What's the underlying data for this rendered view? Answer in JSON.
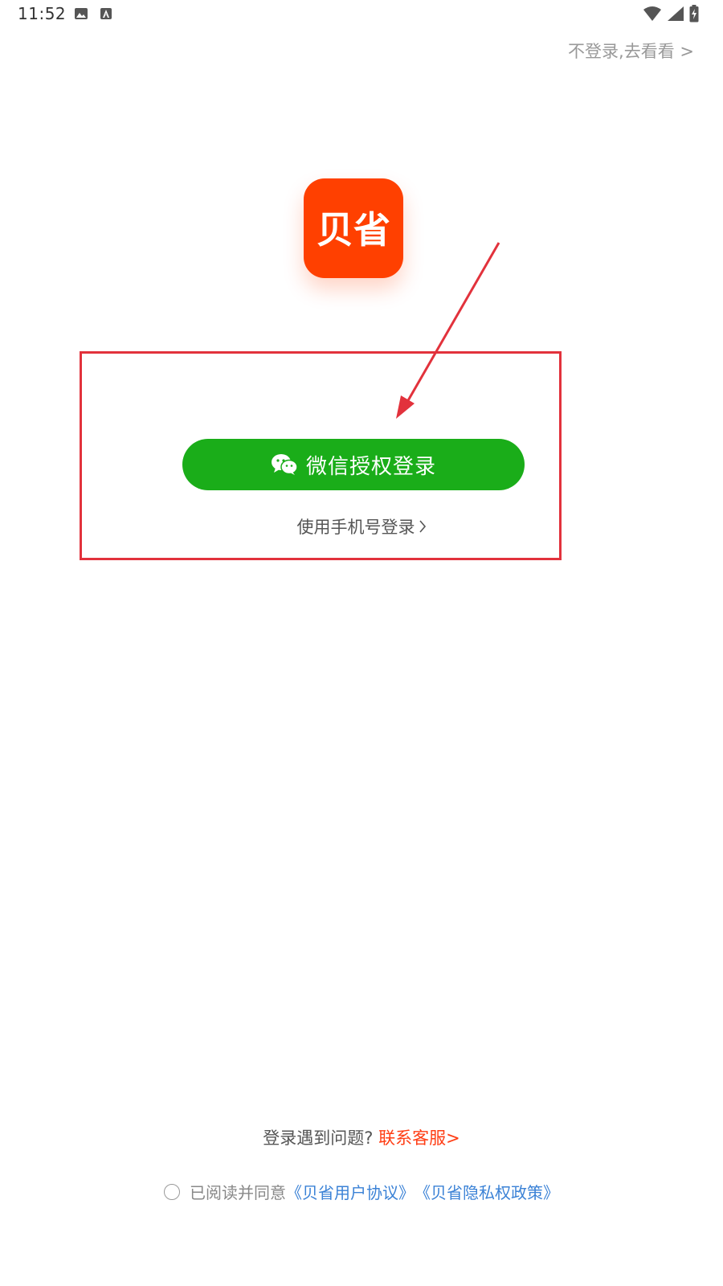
{
  "status_bar": {
    "time": "11:52"
  },
  "header": {
    "skip_label": "不登录,去看看 >"
  },
  "logo": {
    "text": "贝省",
    "color": "#ff4000"
  },
  "login": {
    "wechat_label": "微信授权登录",
    "wechat_color": "#1aad19",
    "phone_label": "使用手机号登录"
  },
  "footer": {
    "help_text": "登录遇到问题?",
    "help_link": "联系客服>",
    "agree_prefix": "已阅读并同意",
    "user_agreement": "《贝省用户协议》",
    "privacy_policy": "《贝省隐私权政策》"
  }
}
